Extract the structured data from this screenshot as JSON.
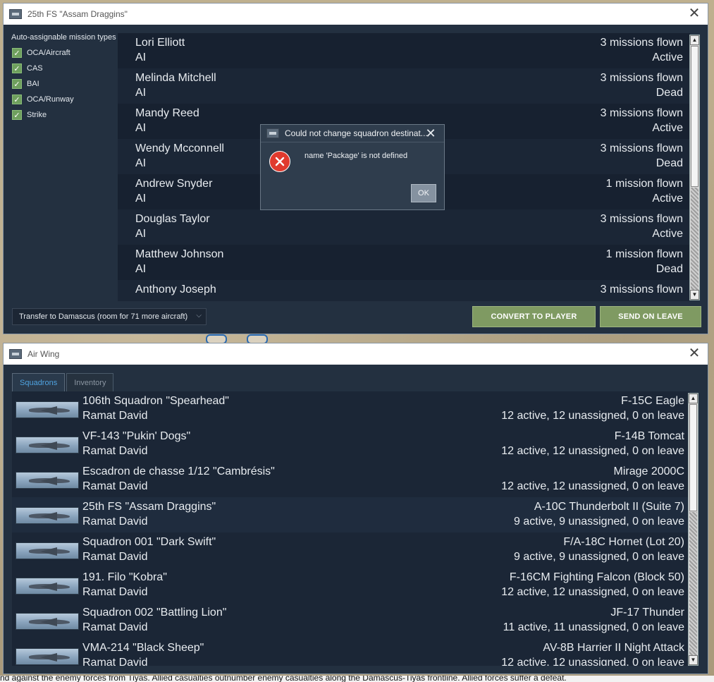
{
  "squadron_window": {
    "title": "25th FS \"Assam Draggins\"",
    "mission_types_heading": "Auto-assignable mission types",
    "mission_types": [
      {
        "label": "OCA/Aircraft",
        "checked": true
      },
      {
        "label": "CAS",
        "checked": true
      },
      {
        "label": "BAI",
        "checked": true
      },
      {
        "label": "OCA/Runway",
        "checked": true
      },
      {
        "label": "Strike",
        "checked": true
      }
    ],
    "pilots": [
      {
        "name": "Lori Elliott",
        "type": "AI",
        "missions": "3 missions flown",
        "status": "Active"
      },
      {
        "name": "Melinda Mitchell",
        "type": "AI",
        "missions": "3 missions flown",
        "status": "Dead"
      },
      {
        "name": "Mandy Reed",
        "type": "AI",
        "missions": "3 missions flown",
        "status": "Active"
      },
      {
        "name": "Wendy Mcconnell",
        "type": "AI",
        "missions": "3 missions flown",
        "status": "Dead"
      },
      {
        "name": "Andrew Snyder",
        "type": "AI",
        "missions": "1 mission flown",
        "status": "Active"
      },
      {
        "name": "Douglas Taylor",
        "type": "AI",
        "missions": "3 missions flown",
        "status": "Active"
      },
      {
        "name": "Matthew Johnson",
        "type": "AI",
        "missions": "1 mission flown",
        "status": "Dead"
      },
      {
        "name": "Anthony Joseph",
        "type": "",
        "missions": "3 missions flown",
        "status": ""
      }
    ],
    "transfer_select": "Transfer to Damascus (room for 71 more aircraft)",
    "convert_button": "CONVERT TO PLAYER",
    "leave_button": "SEND ON LEAVE"
  },
  "error_dialog": {
    "title": "Could not change squadron destinat...",
    "message": "name 'Package' is not defined",
    "ok_label": "OK"
  },
  "air_wing_window": {
    "title": "Air Wing",
    "tabs": [
      {
        "label": "Squadrons",
        "active": true
      },
      {
        "label": "Inventory",
        "active": false
      }
    ],
    "squadrons": [
      {
        "name": "106th Squadron \"Spearhead\"",
        "base": "Ramat David",
        "aircraft": "F-15C Eagle",
        "counts": "12 active, 12 unassigned, 0 on leave"
      },
      {
        "name": "VF-143 \"Pukin' Dogs\"",
        "base": "Ramat David",
        "aircraft": "F-14B Tomcat",
        "counts": "12 active, 12 unassigned, 0 on leave"
      },
      {
        "name": "Escadron de chasse 1/12 \"Cambrésis\"",
        "base": "Ramat David",
        "aircraft": "Mirage 2000C",
        "counts": "12 active, 12 unassigned, 0 on leave"
      },
      {
        "name": "25th FS \"Assam Draggins\"",
        "base": "Ramat David",
        "aircraft": "A-10C Thunderbolt II (Suite 7)",
        "counts": "9 active, 9 unassigned, 0 on leave"
      },
      {
        "name": "Squadron 001 \"Dark Swift\"",
        "base": "Ramat David",
        "aircraft": "F/A-18C Hornet (Lot 20)",
        "counts": "9 active, 9 unassigned, 0 on leave"
      },
      {
        "name": "191. Filo \"Kobra\"",
        "base": "Ramat David",
        "aircraft": "F-16CM Fighting Falcon (Block 50)",
        "counts": "12 active, 12 unassigned, 0 on leave"
      },
      {
        "name": "Squadron 002 \"Battling Lion\"",
        "base": "Ramat David",
        "aircraft": "JF-17 Thunder",
        "counts": "11 active, 11 unassigned, 0 on leave"
      },
      {
        "name": "VMA-214 \"Black Sheep\"",
        "base": "Ramat David",
        "aircraft": "AV-8B Harrier II Night Attack",
        "counts": "12 active, 12 unassigned, 0 on leave"
      }
    ]
  },
  "status_line": "nd against the enemy forces from Tiyas. Allied casualties outnumber enemy casualties along the Damascus-Tiyas frontline. Allied forces suffer a defeat."
}
